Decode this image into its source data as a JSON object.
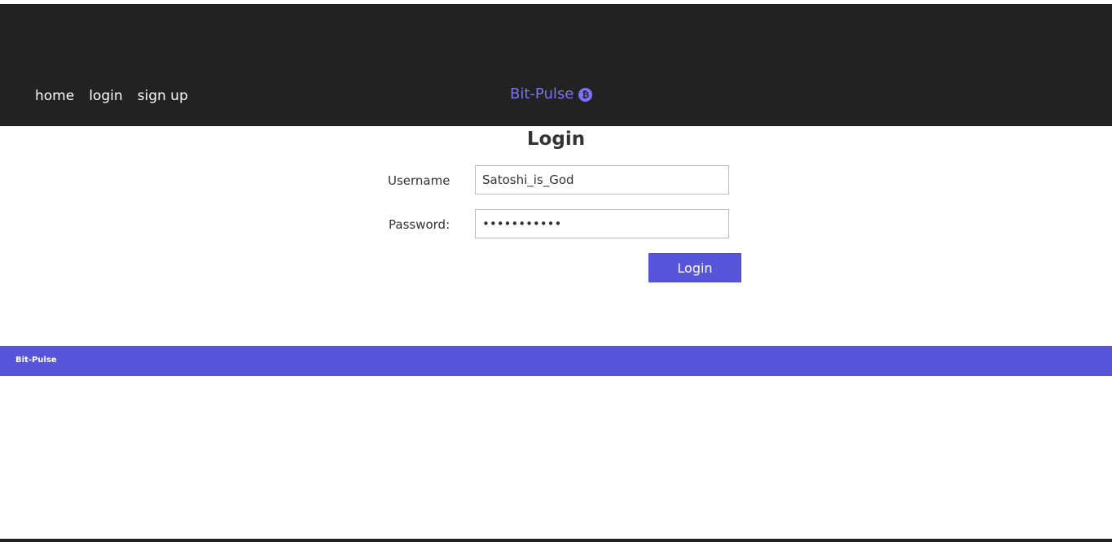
{
  "nav": {
    "home": "home",
    "login": "login",
    "signup": "sign up"
  },
  "brand": {
    "name": "Bit-Pulse",
    "icon": "bitcoin-icon",
    "icon_glyph": "₿",
    "color": "#7b73f0"
  },
  "form": {
    "title": "Login",
    "username_label": "Username",
    "username_value": "Satoshi_is_God",
    "password_label": "Password:",
    "password_value": "Satoshi2009",
    "submit_label": "Login"
  },
  "footer": {
    "text": "Bit-Pulse",
    "color": "#5755d9"
  },
  "colors": {
    "header_bg": "#222222",
    "accent": "#5755d9"
  }
}
